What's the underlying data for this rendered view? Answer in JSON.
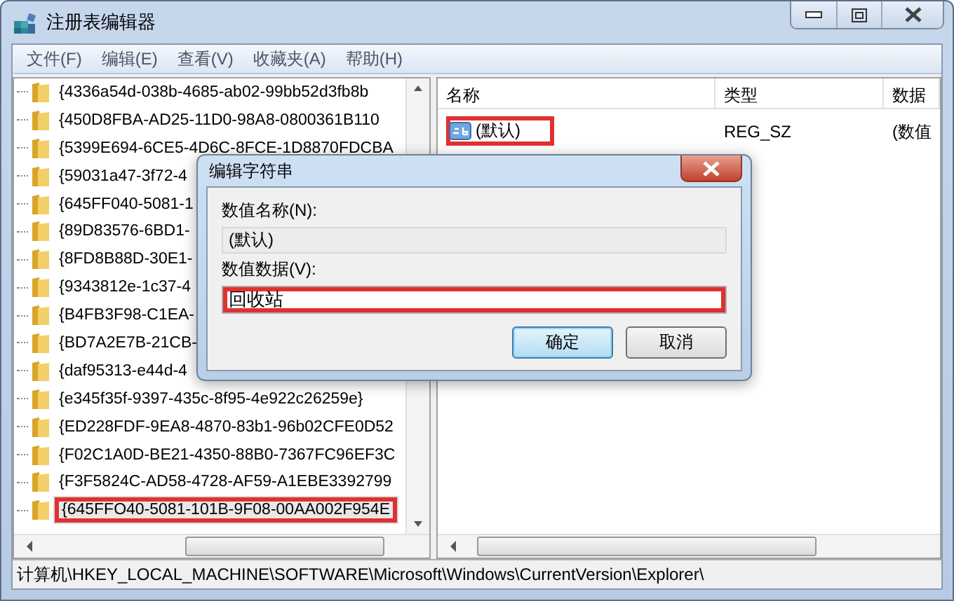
{
  "window": {
    "title": "注册表编辑器"
  },
  "menu": [
    "文件(F)",
    "编辑(E)",
    "查看(V)",
    "收藏夹(A)",
    "帮助(H)"
  ],
  "tree": {
    "items": [
      {
        "label": "{4336a54d-038b-4685-ab02-99bb52d3fb8b",
        "selected": false,
        "highlighted": false
      },
      {
        "label": "{450D8FBA-AD25-11D0-98A8-0800361B110",
        "selected": false,
        "highlighted": false
      },
      {
        "label": "{5399E694-6CE5-4D6C-8FCE-1D8870FDCBA",
        "selected": false,
        "highlighted": false
      },
      {
        "label": "{59031a47-3f72-4",
        "selected": false,
        "highlighted": false
      },
      {
        "label": "{645FF040-5081-1",
        "selected": false,
        "highlighted": false
      },
      {
        "label": "{89D83576-6BD1-",
        "selected": false,
        "highlighted": false
      },
      {
        "label": "{8FD8B88D-30E1-",
        "selected": false,
        "highlighted": false
      },
      {
        "label": "{9343812e-1c37-4",
        "selected": false,
        "highlighted": false
      },
      {
        "label": "{B4FB3F98-C1EA-",
        "selected": false,
        "highlighted": false
      },
      {
        "label": "{BD7A2E7B-21CB-",
        "selected": false,
        "highlighted": false
      },
      {
        "label": "{daf95313-e44d-4",
        "selected": false,
        "highlighted": false
      },
      {
        "label": "{e345f35f-9397-435c-8f95-4e922c26259e}",
        "selected": false,
        "highlighted": false
      },
      {
        "label": "{ED228FDF-9EA8-4870-83b1-96b02CFE0D52",
        "selected": false,
        "highlighted": false
      },
      {
        "label": "{F02C1A0D-BE21-4350-88B0-7367FC96EF3C",
        "selected": false,
        "highlighted": false
      },
      {
        "label": "{F3F5824C-AD58-4728-AF59-A1EBE3392799",
        "selected": false,
        "highlighted": false
      },
      {
        "label": "{645FFO40-5081-101B-9F08-00AA002F954E",
        "selected": true,
        "highlighted": true
      }
    ]
  },
  "values": {
    "columns": [
      "名称",
      "类型",
      "数据"
    ],
    "rows": [
      {
        "name": "(默认)",
        "type": "REG_SZ",
        "data": "(数值",
        "highlighted": true
      }
    ]
  },
  "dialog": {
    "title": "编辑字符串",
    "name_label": "数值名称(N):",
    "name_value": "(默认)",
    "data_label": "数值数据(V):",
    "data_value": "回收站",
    "data_highlighted": true,
    "buttons": [
      {
        "label": "确定",
        "default": true,
        "highlighted": true
      },
      {
        "label": "取消",
        "default": false,
        "highlighted": false
      }
    ]
  },
  "status_bar": "计算机\\HKEY_LOCAL_MACHINE\\SOFTWARE\\Microsoft\\Windows\\CurrentVersion\\Explorer\\"
}
